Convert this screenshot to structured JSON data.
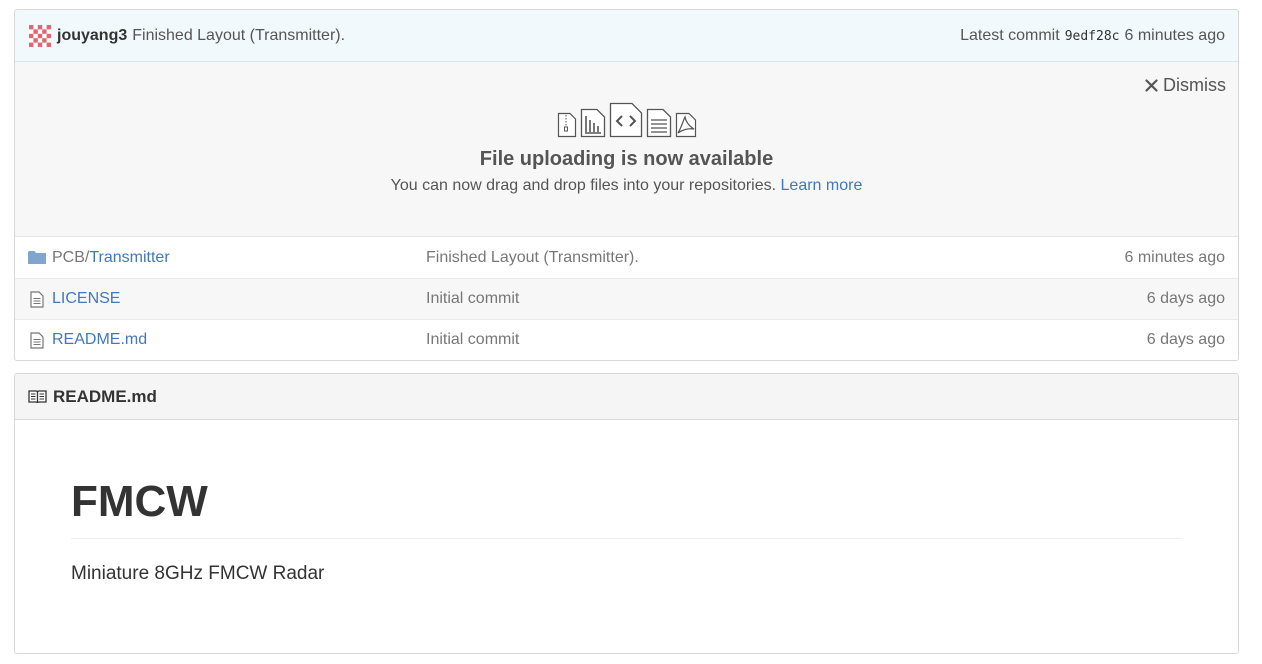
{
  "commit": {
    "author": "jouyang3",
    "message": "Finished Layout (Transmitter).",
    "latest_label": "Latest commit",
    "sha": "9edf28c",
    "time": "6 minutes ago"
  },
  "upload_banner": {
    "dismiss_label": "Dismiss",
    "title": "File uploading is now available",
    "text": "You can now drag and drop files into your repositories.",
    "link": "Learn more",
    "icons": [
      "file-zip-icon",
      "file-chart-icon",
      "file-code-icon",
      "file-text-icon",
      "file-pdf-icon"
    ]
  },
  "files": [
    {
      "icon": "folder-icon",
      "dir_prefix": "PCB/",
      "name": "Transmitter",
      "message": "Finished Layout (Transmitter).",
      "age": "6 minutes ago"
    },
    {
      "icon": "file-icon",
      "dir_prefix": "",
      "name": "LICENSE",
      "message": "Initial commit",
      "age": "6 days ago"
    },
    {
      "icon": "file-icon",
      "dir_prefix": "",
      "name": "README.md",
      "message": "Initial commit",
      "age": "6 days ago"
    }
  ],
  "readme": {
    "filename": "README.md",
    "heading": "FMCW",
    "paragraph": "Miniature 8GHz FMCW Radar"
  },
  "colors": {
    "link": "#4078c0",
    "commit_bg": "#f2f9fc",
    "avatar": "#e06670"
  }
}
